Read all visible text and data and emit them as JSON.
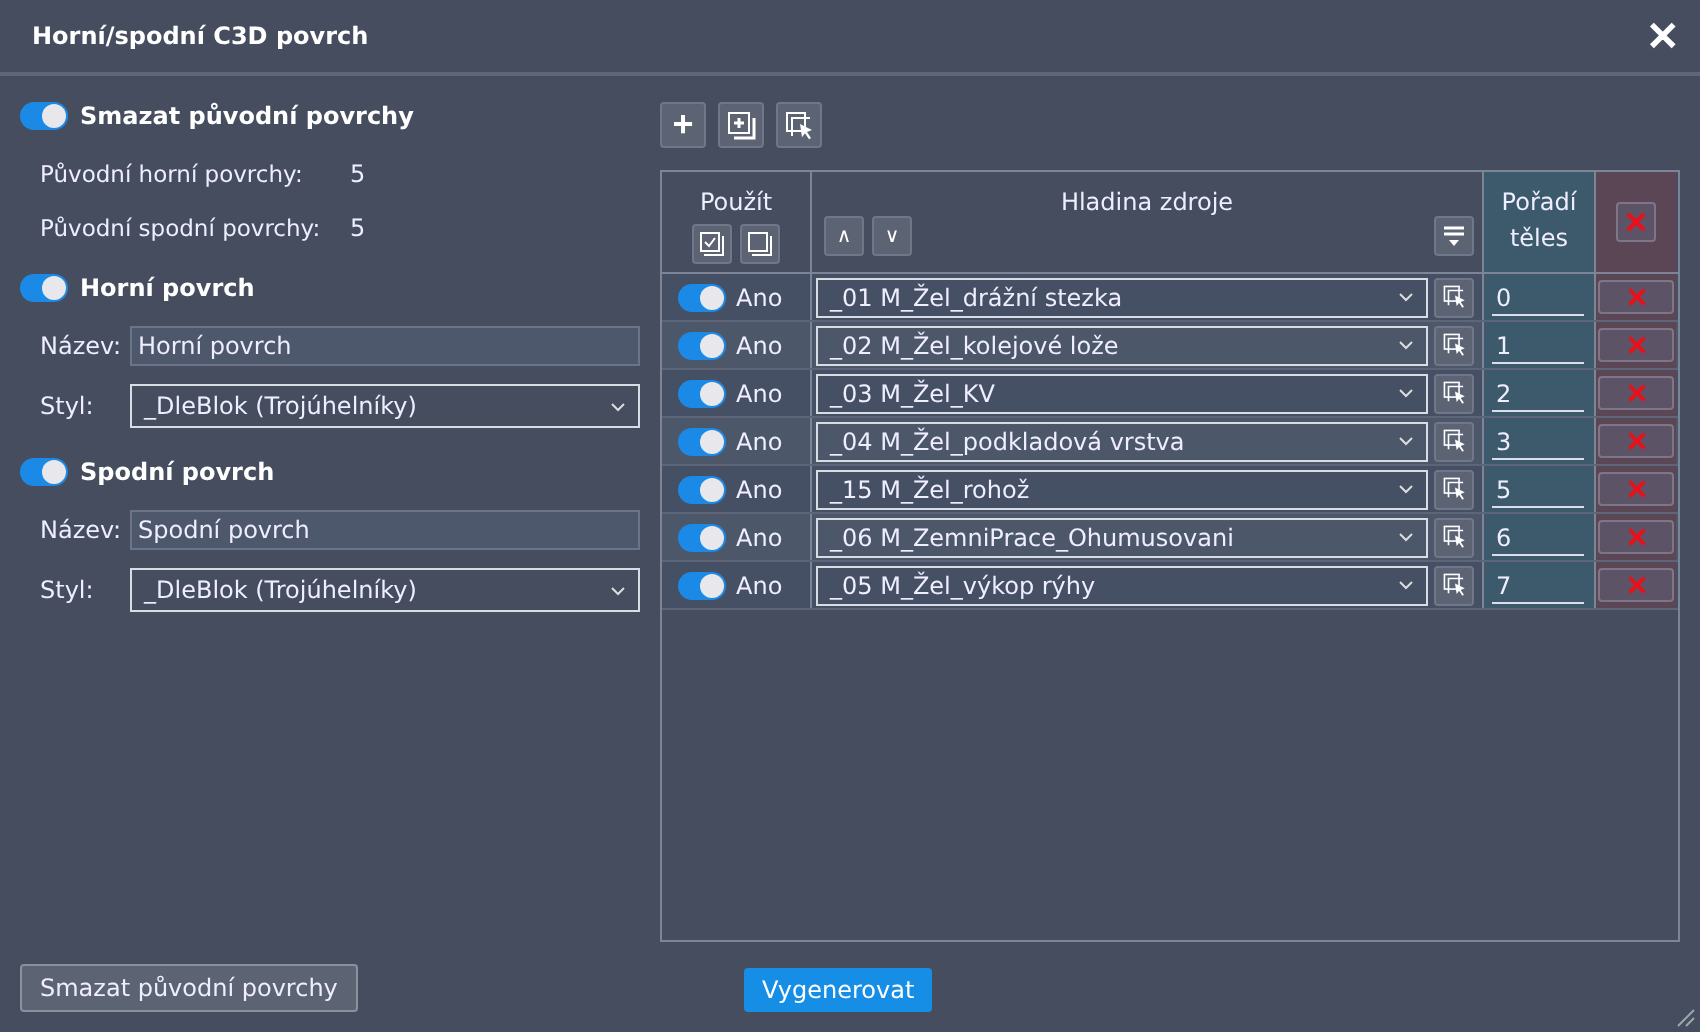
{
  "window": {
    "title": "Horní/spodní C3D povrch",
    "close": "✕"
  },
  "delete_original": {
    "label": "Smazat původní povrchy",
    "on": true,
    "stats": [
      {
        "label": "Původní horní povrchy:",
        "value": "5"
      },
      {
        "label": "Původní spodní povrchy:",
        "value": "5"
      }
    ]
  },
  "surfaces": [
    {
      "label": "Horní povrch",
      "on": true,
      "name_label": "Název:",
      "name": "Horní povrch",
      "style_label": "Styl:",
      "style": "_DleBlok (Trojúhelníky)"
    },
    {
      "label": "Spodní povrch",
      "on": true,
      "name_label": "Název:",
      "name": "Spodní povrch",
      "style_label": "Styl:",
      "style": "_DleBlok (Trojúhelníky)"
    }
  ],
  "toolbar": [
    "+"
  ],
  "table": {
    "columns": [
      "Použít",
      "Hladina zdroje",
      "Pořadí těles"
    ],
    "move_buttons": [
      "∧",
      "∨"
    ],
    "rows": [
      {
        "on": true,
        "label": "Ano",
        "layer": "_01 M_Žel_drážní stezka",
        "order": "0"
      },
      {
        "on": true,
        "label": "Ano",
        "layer": "_02 M_Žel_kolejové lože",
        "order": "1"
      },
      {
        "on": true,
        "label": "Ano",
        "layer": "_03 M_Žel_KV",
        "order": "2"
      },
      {
        "on": true,
        "label": "Ano",
        "layer": "_04 M_Žel_podkladová vrstva",
        "order": "3"
      },
      {
        "on": true,
        "label": "Ano",
        "layer": "_15 M_Žel_rohož",
        "order": "5"
      },
      {
        "on": true,
        "label": "Ano",
        "layer": "_06 M_ZemniPrace_Ohumusovani",
        "order": "6"
      },
      {
        "on": true,
        "label": "Ano",
        "layer": "_05 M_Žel_výkop rýhy",
        "order": "7"
      }
    ]
  },
  "buttons": {
    "delete": "Smazat původní povrchy",
    "generate": "Vygenerovat"
  }
}
